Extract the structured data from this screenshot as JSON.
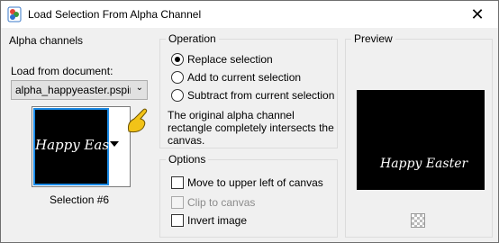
{
  "window": {
    "title": "Load Selection From Alpha Channel",
    "close_glyph": "✕"
  },
  "alpha_channels": {
    "group_label": "Alpha channels",
    "load_from_label": "Load from document:",
    "document_value": "alpha_happyeaster.pspimage",
    "thumbnail_text": "Happy Easter",
    "selection_name": "Selection #6"
  },
  "operation": {
    "group_label": "Operation",
    "options": [
      {
        "label": "Replace selection",
        "selected": true
      },
      {
        "label": "Add to current selection",
        "selected": false
      },
      {
        "label": "Subtract from current selection",
        "selected": false
      }
    ],
    "description": "The original alpha channel rectangle completely intersects the canvas."
  },
  "options": {
    "group_label": "Options",
    "move_upper_left": {
      "label": "Move to upper left of canvas",
      "checked": false
    },
    "clip_to_canvas": {
      "label": "Clip to canvas",
      "checked": false,
      "disabled": true
    },
    "invert_image": {
      "label": "Invert image",
      "checked": false
    }
  },
  "preview": {
    "group_label": "Preview",
    "preview_text": "Happy Easter"
  },
  "colors": {
    "accent_border": "#1a8ae6",
    "pointer_hand": "#f2c318"
  }
}
